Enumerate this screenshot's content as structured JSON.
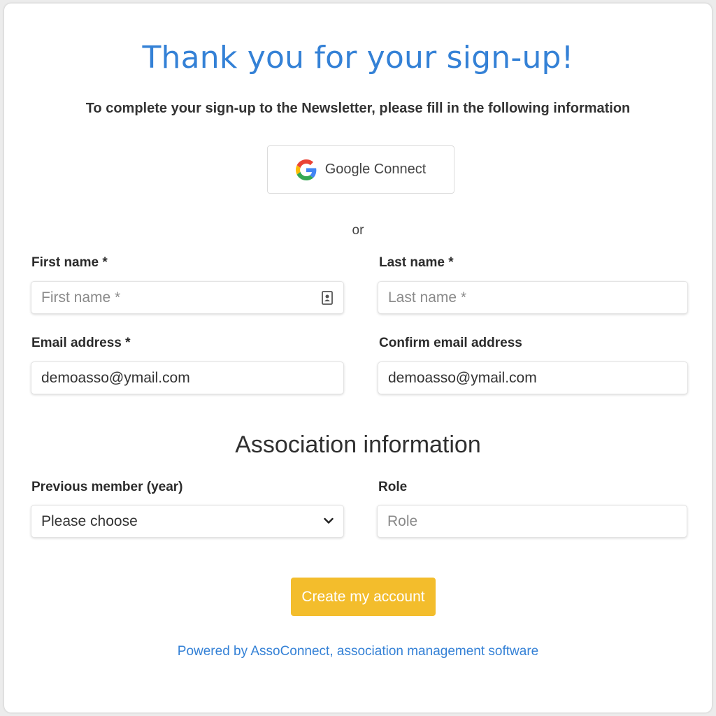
{
  "page": {
    "title": "Thank you for your sign-up!",
    "subtitle": "To complete your sign-up to the Newsletter, please fill in the following information"
  },
  "google": {
    "label": "Google Connect",
    "icon": "google-g-logo"
  },
  "divider": {
    "or": "or"
  },
  "form": {
    "first_name": {
      "label": "First name *",
      "placeholder": "First name *",
      "value": ""
    },
    "last_name": {
      "label": "Last name *",
      "placeholder": "Last name *",
      "value": ""
    },
    "email": {
      "label": "Email address *",
      "value": "demoasso@ymail.com"
    },
    "confirm_email": {
      "label": "Confirm email address",
      "value": "demoasso@ymail.com"
    }
  },
  "association": {
    "title": "Association information",
    "previous_member": {
      "label": "Previous member (year)",
      "selected": "Please choose"
    },
    "role": {
      "label": "Role",
      "placeholder": "Role",
      "value": ""
    }
  },
  "submit": {
    "label": "Create my account"
  },
  "footer": {
    "powered_by": "Powered by AssoConnect, association management software"
  },
  "colors": {
    "accent": "#3481d6",
    "button": "#f3bd2c",
    "background": "#ececec"
  }
}
